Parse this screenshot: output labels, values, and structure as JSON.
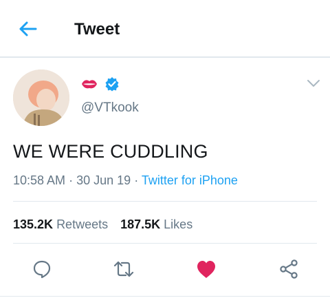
{
  "header": {
    "title": "Tweet",
    "back_icon": "back-arrow-icon"
  },
  "tweet": {
    "author_emoji_icon": "lips-icon",
    "verified_icon": "verified-badge-icon",
    "handle": "@VTkook",
    "text": "WE WERE CUDDLING",
    "time": "10:58 AM",
    "date": "30 Jun 19",
    "source": "Twitter for iPhone",
    "separator": "·",
    "stats": {
      "retweets_count": "135.2K",
      "retweets_label": "Retweets",
      "likes_count": "187.5K",
      "likes_label": "Likes"
    }
  },
  "actions": [
    "reply-icon",
    "retweet-icon",
    "like-icon",
    "share-icon"
  ],
  "colors": {
    "accent": "#1da1f2",
    "like": "#e0245e",
    "secondary_text": "#657786",
    "divider": "#e1e8ed"
  }
}
